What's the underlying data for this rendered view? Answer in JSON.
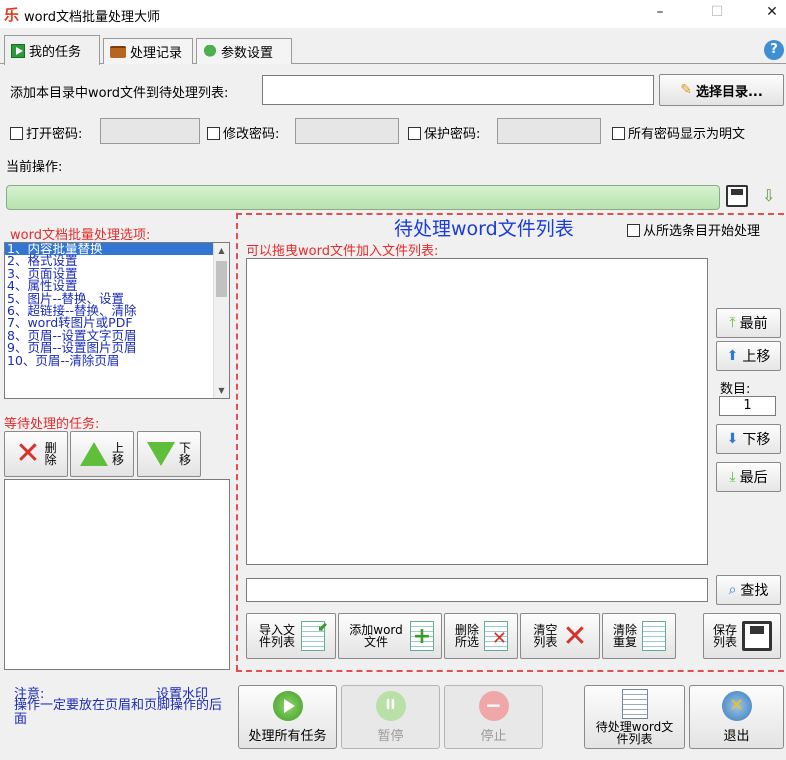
{
  "window": {
    "title": "word文档批量处理大师",
    "min": "–",
    "max": "☐",
    "close": "✕"
  },
  "tabs": [
    {
      "label": "我的任务"
    },
    {
      "label": "处理记录"
    },
    {
      "label": "参数设置"
    }
  ],
  "help": "?",
  "dir_row": {
    "label": "添加本目录中word文件到待处理列表:",
    "value": "",
    "button": "选择目录..."
  },
  "passwords": {
    "open": "打开密码:",
    "modify": "修改密码:",
    "protect": "保护密码:",
    "show_plain": "所有密码显示为明文"
  },
  "current_op": {
    "label": "当前操作:",
    "progress": 0
  },
  "options": {
    "title": "word文档批量处理选项:",
    "items": [
      "1、内容批量替换",
      "2、格式设置",
      "3、页面设置",
      "4、属性设置",
      "5、图片--替换、设置",
      "6、超链接--替换、清除",
      "7、word转图片或PDF",
      "8、页眉--设置文字页眉",
      "9、页眉--设置图片页眉",
      "10、页眉--清除页眉"
    ]
  },
  "tasks": {
    "title": "等待处理的任务:",
    "delete": "删除",
    "up": "上移",
    "down": "下移"
  },
  "filelist": {
    "title": "待处理word文件列表",
    "from_selected": "从所选条目开始处理",
    "hint": "可以拖曳word文件加入文件列表:"
  },
  "side": {
    "first": "最前",
    "up": "上移",
    "count_label": "数目:",
    "count": "1",
    "down": "下移",
    "last": "最后"
  },
  "search": {
    "value": "",
    "button": "查找"
  },
  "listbtns": {
    "import": "导入文件列表",
    "add": "添加word文件",
    "delete_sel": "删除所选",
    "clear": "清空列表",
    "dedupe": "清除重复",
    "save": "保存列表"
  },
  "note": {
    "label": "注意:",
    "link": "设置水印",
    "text": "操作一定要放在页眉和页脚操作的后面"
  },
  "bottom": {
    "process_all": "处理所有任务",
    "pause": "暂停",
    "stop": "停止",
    "pending": "待处理word文件列表",
    "exit": "退出"
  }
}
